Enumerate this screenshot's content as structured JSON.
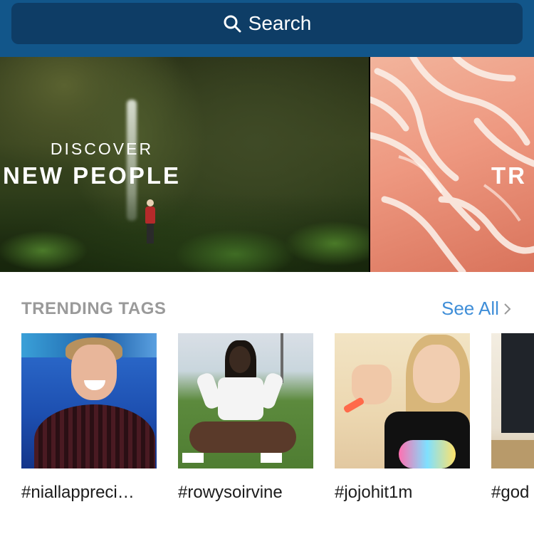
{
  "search": {
    "label": "Search"
  },
  "carousel": {
    "cards": [
      {
        "kicker": "DISCOVER",
        "headline": "NEW PEOPLE"
      },
      {
        "headline": "TR"
      }
    ]
  },
  "trending": {
    "title": "TRENDING TAGS",
    "see_all": "See All",
    "tags": [
      {
        "label": "#niallappreci…"
      },
      {
        "label": "#rowysoirvine"
      },
      {
        "label": "#jojohit1m"
      },
      {
        "label": "#god"
      }
    ]
  },
  "colors": {
    "topbar": "#12568a",
    "search_field": "#0e3d66",
    "link": "#3f8ed8",
    "section_title": "#9a9a9a"
  }
}
